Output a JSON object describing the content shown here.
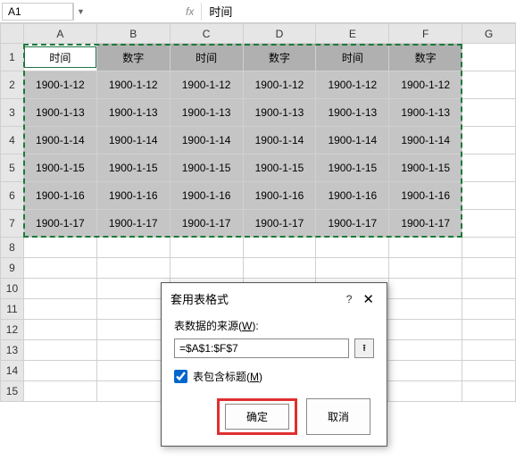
{
  "name_box": "A1",
  "fx_label": "fx",
  "formula_value": "时间",
  "columns": [
    "A",
    "B",
    "C",
    "D",
    "E",
    "F",
    "G"
  ],
  "row_nums": [
    1,
    2,
    3,
    4,
    5,
    6,
    7,
    8,
    9,
    10,
    11,
    12,
    13,
    14,
    15
  ],
  "headers": [
    "时间",
    "数字",
    "时间",
    "数字",
    "时间",
    "数字"
  ],
  "rows": [
    [
      "1900-1-12",
      "1900-1-12",
      "1900-1-12",
      "1900-1-12",
      "1900-1-12",
      "1900-1-12"
    ],
    [
      "1900-1-13",
      "1900-1-13",
      "1900-1-13",
      "1900-1-13",
      "1900-1-13",
      "1900-1-13"
    ],
    [
      "1900-1-14",
      "1900-1-14",
      "1900-1-14",
      "1900-1-14",
      "1900-1-14",
      "1900-1-14"
    ],
    [
      "1900-1-15",
      "1900-1-15",
      "1900-1-15",
      "1900-1-15",
      "1900-1-15",
      "1900-1-15"
    ],
    [
      "1900-1-16",
      "1900-1-16",
      "1900-1-16",
      "1900-1-16",
      "1900-1-16",
      "1900-1-16"
    ],
    [
      "1900-1-17",
      "1900-1-17",
      "1900-1-17",
      "1900-1-17",
      "1900-1-17",
      "1900-1-17"
    ]
  ],
  "dialog": {
    "title": "套用表格式",
    "help": "?",
    "close": "✕",
    "source_label_pre": "表数据的来源(",
    "source_label_u": "W",
    "source_label_post": "):",
    "range_value": "=$A$1:$F$7",
    "range_btn_icon": "⭱",
    "headers_label_pre": "表包含标题(",
    "headers_label_u": "M",
    "headers_label_post": ")",
    "headers_checked": true,
    "ok": "确定",
    "cancel": "取消"
  }
}
